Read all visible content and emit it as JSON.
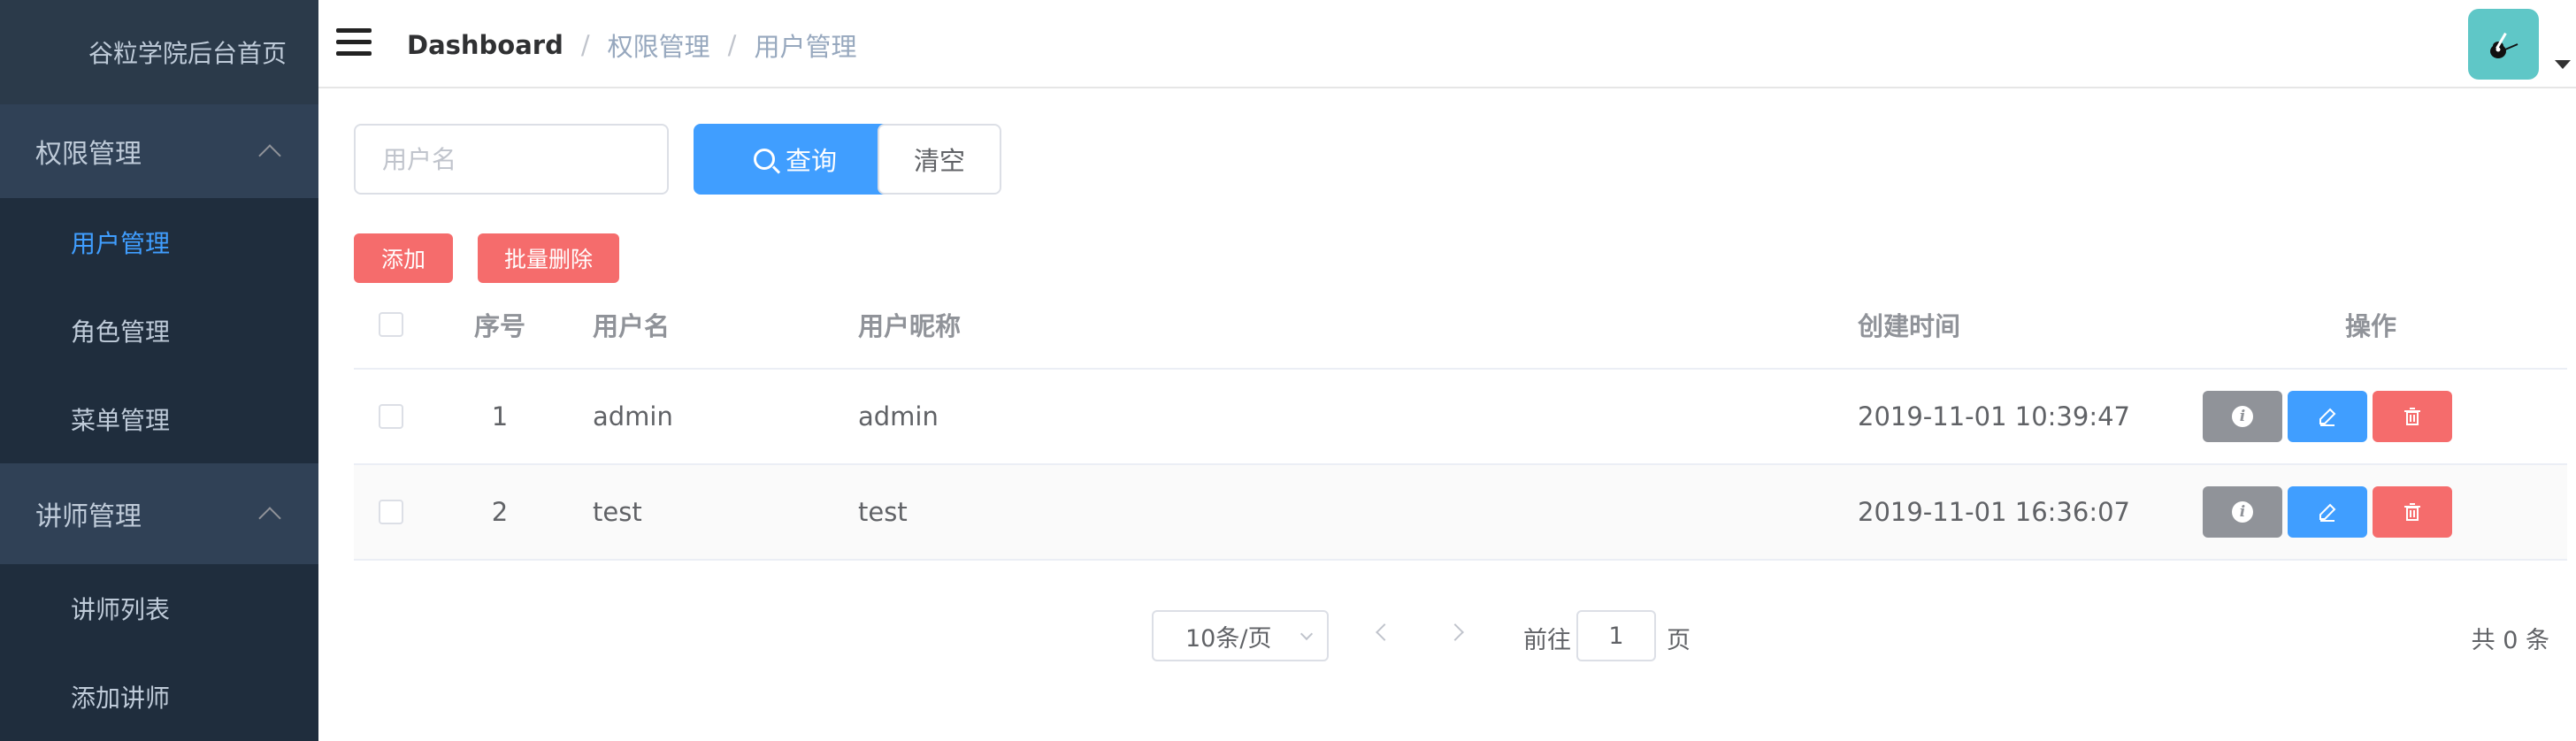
{
  "sidebar": {
    "brand": "谷粒学院后台首页",
    "groups": [
      {
        "title": "权限管理",
        "items": [
          "用户管理",
          "角色管理",
          "菜单管理"
        ]
      },
      {
        "title": "讲师管理",
        "items": [
          "讲师列表",
          "添加讲师"
        ]
      }
    ]
  },
  "header": {
    "breadcrumb": [
      "Dashboard",
      "权限管理",
      "用户管理"
    ],
    "separator": "/"
  },
  "search": {
    "placeholder": "用户名",
    "value": "",
    "query_label": "查询",
    "clear_label": "清空"
  },
  "actions": {
    "add_label": "添加",
    "batch_delete_label": "批量删除"
  },
  "table": {
    "columns": [
      "序号",
      "用户名",
      "用户昵称",
      "创建时间",
      "操作"
    ],
    "rows": [
      {
        "index": "1",
        "username": "admin",
        "nickname": "admin",
        "created": "2019-11-01 10:39:47"
      },
      {
        "index": "2",
        "username": "test",
        "nickname": "test",
        "created": "2019-11-01 16:36:07"
      }
    ]
  },
  "pagination": {
    "page_size": "10条/页",
    "goto_prefix": "前往",
    "current_page": "1",
    "goto_suffix": "页",
    "total": "共 0 条"
  },
  "colors": {
    "primary": "#409eff",
    "danger": "#f56c6c",
    "info": "#909399",
    "sidebar_bg": "#1f2d3d"
  }
}
